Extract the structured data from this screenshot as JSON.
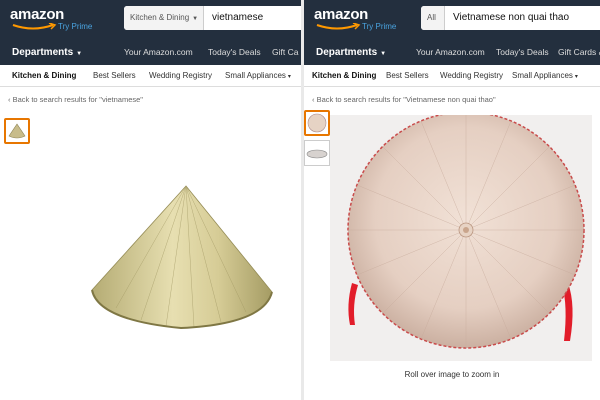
{
  "left": {
    "logo_text": "amazon",
    "logo_subtext": "Try Prime",
    "search_category": "Kitchen & Dining",
    "search_value": "vietnamese",
    "departments_label": "Departments",
    "nav_links": [
      "Your Amazon.com",
      "Today's Deals",
      "Gift Ca"
    ],
    "subnav": [
      "Kitchen & Dining",
      "Best Sellers",
      "Wedding Registry",
      "Small Appliances"
    ],
    "back_link": "‹ Back to search results for \"vietnamese\""
  },
  "right": {
    "logo_text": "amazon",
    "logo_subtext": "Try Prime",
    "search_category": "All",
    "search_value": "Vietnamese non quai thao",
    "departments_label": "Departments",
    "nav_links": [
      "Your Amazon.com",
      "Today's Deals",
      "Gift Cards & "
    ],
    "subnav": [
      "Kitchen & Dining",
      "Best Sellers",
      "Wedding Registry",
      "Small Appliances"
    ],
    "back_link": "‹ Back to search results for \"Vietnamese non quai thao\"",
    "zoom_hint": "Roll over image to zoom in"
  },
  "colors": {
    "header": "#232f3e",
    "accent_orange": "#e77600",
    "prime_blue": "#4aa3df"
  }
}
